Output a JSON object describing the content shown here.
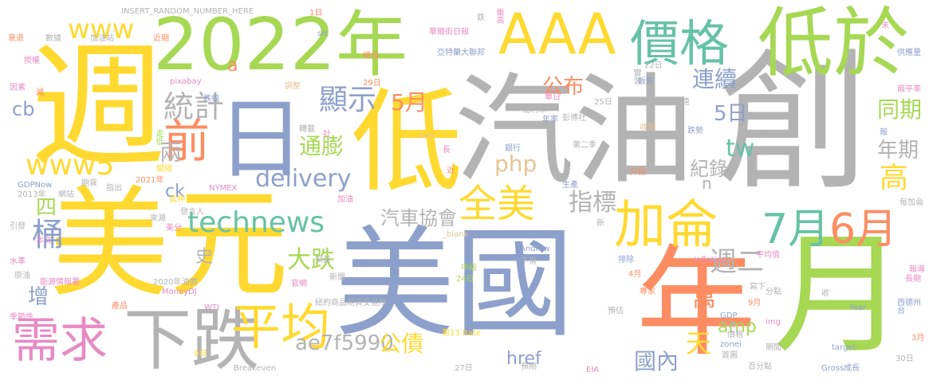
{
  "palette": {
    "green": "#a6d854",
    "yellow": "#ffd92f",
    "gray": "#b3b3b3",
    "blue": "#8da0cb",
    "orange": "#fc8d62",
    "teal": "#66c2a5",
    "pink": "#e78ac3",
    "tan": "#e5c494"
  },
  "words": [
    {
      "text": "美元",
      "color": "#ffd92f"
    },
    {
      "text": "美國",
      "color": "#8da0cb"
    },
    {
      "text": "汽油",
      "color": "#b3b3b3"
    },
    {
      "text": "週",
      "color": "#ffd92f"
    },
    {
      "text": "創",
      "color": "#b3b3b3"
    },
    {
      "text": "2022年",
      "color": "#a6d854"
    },
    {
      "text": "年",
      "color": "#fc8d62"
    },
    {
      "text": "月",
      "color": "#a6d854"
    },
    {
      "text": "低",
      "color": "#ffd92f"
    },
    {
      "text": "AAA",
      "color": "#ffd92f"
    },
    {
      "text": "低於",
      "color": "#a6d854"
    },
    {
      "text": "日",
      "color": "#8da0cb"
    },
    {
      "text": "價格",
      "color": "#66c2a5"
    },
    {
      "text": "下跌",
      "color": "#b3b3b3"
    },
    {
      "text": "需求",
      "color": "#e78ac3"
    },
    {
      "text": "平均",
      "color": "#ffd92f"
    },
    {
      "text": "加侖",
      "color": "#ffd92f"
    },
    {
      "text": "7月",
      "color": "#66c2a5"
    },
    {
      "text": "6月",
      "color": "#fc8d62"
    },
    {
      "text": "全美",
      "color": "#ffd92f"
    },
    {
      "text": "technews",
      "color": "#66c2a5"
    },
    {
      "text": "www5",
      "color": "#ffd92f"
    },
    {
      "text": "www",
      "color": "#ffd92f"
    },
    {
      "text": "前",
      "color": "#fc8d62"
    },
    {
      "text": "統計",
      "color": "#b3b3b3"
    },
    {
      "text": "顯示",
      "color": "#8da0cb"
    },
    {
      "text": "delivery",
      "color": "#8da0cb"
    },
    {
      "text": "php",
      "color": "#e5c494"
    },
    {
      "text": "大跌",
      "color": "#a6d854"
    },
    {
      "text": "汽車協會",
      "color": "#b3b3b3"
    },
    {
      "text": "指標",
      "color": "#b3b3b3"
    },
    {
      "text": "ae7f5990",
      "color": "#b3b3b3"
    },
    {
      "text": "公債",
      "color": "#ffd92f"
    },
    {
      "text": "href",
      "color": "#8da0cb"
    },
    {
      "text": "國內",
      "color": "#8da0cb"
    },
    {
      "text": "萬",
      "color": "#fc8d62"
    },
    {
      "text": "天",
      "color": "#ffd92f"
    },
    {
      "text": "amp",
      "color": "#a6d854"
    },
    {
      "text": "週二",
      "color": "#b3b3b3"
    },
    {
      "text": "5日",
      "color": "#8da0cb"
    },
    {
      "text": "tw",
      "color": "#66c2a5"
    },
    {
      "text": "紀錄",
      "color": "#b3b3b3"
    },
    {
      "text": "5月",
      "color": "#fc8d62"
    },
    {
      "text": "公布",
      "color": "#fc8d62"
    },
    {
      "text": "連續",
      "color": "#8da0cb"
    },
    {
      "text": "同期",
      "color": "#a6d854"
    },
    {
      "text": "年期",
      "color": "#b3b3b3"
    },
    {
      "text": "高",
      "color": "#ffd92f"
    },
    {
      "text": "通膨",
      "color": "#a6d854"
    },
    {
      "text": "兩",
      "color": "#b3b3b3"
    },
    {
      "text": "四",
      "color": "#a6d854"
    },
    {
      "text": "桶",
      "color": "#8da0cb"
    },
    {
      "text": "ck",
      "color": "#8da0cb"
    },
    {
      "text": "cb",
      "color": "#8da0cb"
    },
    {
      "text": "史",
      "color": "#b3b3b3"
    },
    {
      "text": "增",
      "color": "#8da0cb"
    },
    {
      "text": "n",
      "color": "#b3b3b3"
    },
    {
      "text": "a",
      "color": "#fc8d62"
    },
    {
      "text": "INSERT_RANDOM_NUMBER_HERE",
      "color": "#b3b3b3"
    },
    {
      "text": "1日",
      "color": "#fc8d62"
    },
    {
      "text": "衝高",
      "color": "#e78ac3"
    },
    {
      "text": "鉄",
      "color": "#b3b3b3"
    },
    {
      "text": "華爾街日報",
      "color": "#e78ac3"
    },
    {
      "text": "亞特蘭大聯邦",
      "color": "#8da0cb"
    },
    {
      "text": "總值",
      "color": "#fc8d62"
    },
    {
      "text": "src",
      "color": "#8da0cb"
    },
    {
      "text": "加油站",
      "color": "#b3b3b3"
    },
    {
      "text": "近期",
      "color": "#fc8d62"
    },
    {
      "text": "數據",
      "color": "#b3b3b3"
    },
    {
      "text": "衰退",
      "color": "#fc8d62"
    },
    {
      "text": "授權",
      "color": "#e78ac3"
    },
    {
      "text": "因素",
      "color": "#e78ac3"
    },
    {
      "text": "減",
      "color": "#fc8d62"
    },
    {
      "text": "pixabay",
      "color": "#e78ac3"
    },
    {
      "text": "調整",
      "color": "#e5c494"
    },
    {
      "text": "跌幅",
      "color": "#8da0cb"
    },
    {
      "text": "走低",
      "color": "#a6d854"
    },
    {
      "text": "間隔",
      "color": "#ffd92f"
    },
    {
      "text": "期貨",
      "color": "#b3b3b3"
    },
    {
      "text": "指出",
      "color": "#b3b3b3"
    },
    {
      "text": "2021年",
      "color": "#fc8d62"
    },
    {
      "text": "GDPNow",
      "color": "#8da0cb"
    },
    {
      "text": "2013年",
      "color": "#b3b3b3"
    },
    {
      "text": "網站",
      "color": "#b3b3b3"
    },
    {
      "text": "延伸",
      "color": "#ffd92f"
    },
    {
      "text": "NYMEX",
      "color": "#e78ac3"
    },
    {
      "text": "發言人",
      "color": "#b3b3b3"
    },
    {
      "text": "來源",
      "color": "#b3b3b3"
    },
    {
      "text": "美分",
      "color": "#e78ac3"
    },
    {
      "text": "引發",
      "color": "#b3b3b3"
    },
    {
      "text": "本文",
      "color": "#e78ac3"
    },
    {
      "text": "水準",
      "color": "#e78ac3"
    },
    {
      "text": "原油",
      "color": "#b3b3b3"
    },
    {
      "text": "能源情報署",
      "color": "#e78ac3"
    },
    {
      "text": "2020年油價",
      "color": "#b3b3b3"
    },
    {
      "text": "MoneyDJ",
      "color": "#e78ac3"
    },
    {
      "text": "產品",
      "color": "#fc8d62"
    },
    {
      "text": "季節性",
      "color": "#e78ac3"
    },
    {
      "text": "WTI",
      "color": "#e78ac3"
    },
    {
      "text": "9日",
      "color": "#ffd92f"
    },
    {
      "text": "Breakeven",
      "color": "#b3b3b3"
    },
    {
      "text": "27日",
      "color": "#b3b3b3"
    },
    {
      "text": "EIA",
      "color": "#e78ac3"
    },
    {
      "text": "Gross成長",
      "color": "#8da0cb"
    },
    {
      "text": "30日",
      "color": "#b3b3b3"
    },
    {
      "text": "3月",
      "color": "#fc8d62"
    },
    {
      "text": "target",
      "color": "#8da0cb"
    },
    {
      "text": "Year",
      "color": "#8da0cb"
    },
    {
      "text": "西德州",
      "color": "#8da0cb"
    },
    {
      "text": "長期",
      "color": "#e78ac3"
    },
    {
      "text": "報導",
      "color": "#e78ac3"
    },
    {
      "text": "每加侖",
      "color": "#b3b3b3"
    },
    {
      "text": "報",
      "color": "#8da0cb"
    },
    {
      "text": "兩平率",
      "color": "#e78ac3"
    },
    {
      "text": "供應量",
      "color": "#8da0cb"
    },
    {
      "text": "末",
      "color": "#e78ac3"
    },
    {
      "text": "22日",
      "color": "#b3b3b3"
    },
    {
      "text": "實習",
      "color": "#b3b3b3"
    },
    {
      "text": "販售",
      "color": "#8da0cb"
    },
    {
      "text": "單日",
      "color": "#e78ac3"
    },
    {
      "text": "25日",
      "color": "#b3b3b3"
    },
    {
      "text": "隨利率",
      "color": "#b3b3b3"
    },
    {
      "text": "彭博社",
      "color": "#b3b3b3"
    },
    {
      "text": "年率",
      "color": "#8da0cb"
    },
    {
      "text": "第二季",
      "color": "#b3b3b3"
    },
    {
      "text": "銀行",
      "color": "#8da0cb"
    },
    {
      "text": "收盤",
      "color": "#e5c494"
    },
    {
      "text": "跌勢",
      "color": "#8da0cb"
    },
    {
      "text": "升段",
      "color": "#fc8d62"
    },
    {
      "text": "生產",
      "color": "#8da0cb"
    },
    {
      "text": "新",
      "color": "#b3b3b3"
    },
    {
      "text": "Andrew",
      "color": "#8da0cb"
    },
    {
      "text": "_blank",
      "color": "#e5c494"
    },
    {
      "text": "加油",
      "color": "#e78ac3"
    },
    {
      "text": "近",
      "color": "#fc8d62"
    },
    {
      "text": "長",
      "color": "#e78ac3"
    },
    {
      "text": "avw",
      "color": "#e5c494"
    },
    {
      "text": "轉載",
      "color": "#b3b3b3"
    },
    {
      "text": "計",
      "color": "#e78ac3"
    },
    {
      "text": "29日",
      "color": "#fc8d62"
    },
    {
      "text": "遠",
      "color": "#b3b3b3"
    },
    {
      "text": "紐約商品期貨交易所",
      "color": "#b3b3b3"
    },
    {
      "text": "新聞",
      "color": "#b3b3b3"
    },
    {
      "text": "官網",
      "color": "#e78ac3"
    },
    {
      "text": "損益",
      "color": "#b3b3b3"
    },
    {
      "text": "中級",
      "color": "#a6d854"
    },
    {
      "text": "24日",
      "color": "#a6d854"
    },
    {
      "text": "第13",
      "color": "#ffd92f"
    },
    {
      "text": "Rate",
      "color": "#ffd92f"
    },
    {
      "text": "預期",
      "color": "#b3b3b3"
    },
    {
      "text": "下滑",
      "color": "#b3b3b3"
    },
    {
      "text": "預估",
      "color": "#b3b3b3"
    },
    {
      "text": "排除",
      "color": "#8da0cb"
    },
    {
      "text": "4月",
      "color": "#fc8d62"
    },
    {
      "text": "專家",
      "color": "#fc8d62"
    },
    {
      "text": "Inflation",
      "color": "#e78ac3"
    },
    {
      "text": "平均值",
      "color": "#e78ac3"
    },
    {
      "text": "分點",
      "color": "#b3b3b3"
    },
    {
      "text": "寫下",
      "color": "#b3b3b3"
    },
    {
      "text": "收",
      "color": "#b3b3b3"
    },
    {
      "text": "9月",
      "color": "#fc8d62"
    },
    {
      "text": "GDP",
      "color": "#8da0cb"
    },
    {
      "text": "下滑",
      "color": "#b3b3b3"
    },
    {
      "text": "img",
      "color": "#e78ac3"
    },
    {
      "text": "價格",
      "color": "#b3b3b3"
    },
    {
      "text": "期間",
      "color": "#b3b3b3"
    },
    {
      "text": "zonei",
      "color": "#8da0cb"
    },
    {
      "text": "首圖",
      "color": "#b3b3b3"
    },
    {
      "text": "百分點",
      "color": "#b3b3b3"
    },
    {
      "text": "台",
      "color": "#8da0cb"
    }
  ]
}
